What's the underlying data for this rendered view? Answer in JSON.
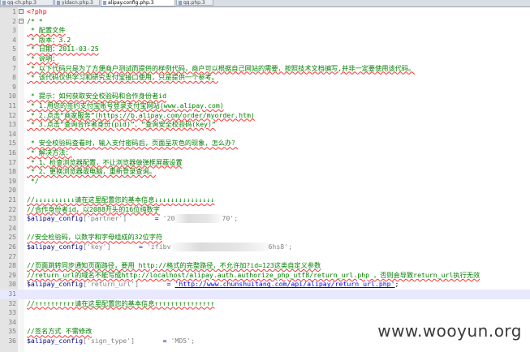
{
  "tabs": [
    {
      "label": "qq-ch.php.3",
      "active": false
    },
    {
      "label": "yidacn.php.3",
      "active": false
    },
    {
      "label": "alipay.config.php.3",
      "active": true
    },
    {
      "label": "qq.php.3",
      "active": false
    }
  ],
  "lines": [
    {
      "n": "1",
      "text": "<?php"
    },
    {
      "n": "2",
      "text": "/* *"
    },
    {
      "n": "3",
      "text": " * 配置文件"
    },
    {
      "n": "4",
      "text": " * 版本：3.2"
    },
    {
      "n": "5",
      "text": " * 日期：2011-03-25"
    },
    {
      "n": "6",
      "text": " * 说明："
    },
    {
      "n": "7",
      "text": " * 以下代码只是为了方便商户测试而提供的样例代码，商户可以根据自己网站的需要，按照技术文档编写,并非一定要使用该代码。"
    },
    {
      "n": "8",
      "text": " * 该代码仅供学习和研究支付宝接口使用，只是提供一个参考。"
    },
    {
      "n": "9",
      "text": ""
    },
    {
      "n": "10",
      "text": " * 提示：如何获取安全校验码和合作身份者id"
    },
    {
      "n": "11",
      "text": " * 1.用您的签约支付宝账号登录支付宝网站(www.alipay.com)"
    },
    {
      "n": "12",
      "text": " * 2.点击“商家服务”(https://b.alipay.com/order/myorder.htm)"
    },
    {
      "n": "13",
      "text": " * 3.点击“查询合作者身份(pid)”、“查询安全校验码(key)”"
    },
    {
      "n": "14",
      "text": ""
    },
    {
      "n": "15",
      "text": " * 安全校验码查看时，输入支付密码后，页面呈灰色的现象，怎么办？"
    },
    {
      "n": "16",
      "text": " * 解决方法："
    },
    {
      "n": "17",
      "text": " * 1、检查浏览器配置，不让浏览器做弹框屏蔽设置"
    },
    {
      "n": "18",
      "text": " * 2、更换浏览器或电脑，重新登录查询。"
    },
    {
      "n": "19",
      "text": " */"
    },
    {
      "n": "20",
      "text": ""
    },
    {
      "n": "21",
      "text": "//↓↓↓↓↓↓↓↓↓↓请在这里配置您的基本信息↓↓↓↓↓↓↓↓↓↓↓↓↓↓↓"
    },
    {
      "n": "22",
      "text": "//合作身份者id，以2088开头的16位纯数字"
    },
    {
      "n": "23",
      "var": "$alipay_config",
      "key": "['partner']",
      "eq": "=",
      "val_pre": "'20",
      "val_post": "70';"
    },
    {
      "n": "24",
      "text": ""
    },
    {
      "n": "25",
      "text": "//安全检验码，以数字和字母组成的32位字符"
    },
    {
      "n": "26",
      "var": "$alipay_config",
      "key": "['key']",
      "eq": "=",
      "val_pre": "'zfibv",
      "val_post": "6hs8';"
    },
    {
      "n": "27",
      "text": ""
    },
    {
      "n": "28",
      "text": "//页面跳转同步通知页面路径，要用 http://格式的完整路径，不允许加?id=123这类自定义参数"
    },
    {
      "n": "29",
      "text": "//return_url的域名不能写成http://localhost/alipay.auth.authorize_php_utf8/return_url.php ，否则会导致return_url执行无效"
    },
    {
      "n": "30",
      "var": "$alipay_config",
      "key": "['return_url']",
      "eq": "=",
      "val_url": "'http://www.chunshuitang.com/api/alipay/return_url.php'",
      "tail": ";"
    },
    {
      "n": "31",
      "text": ""
    },
    {
      "n": "32",
      "text": "//↑↑↑↑↑↑↑↑↑↑请在这里配置您的基本信息↑↑↑↑↑↑↑↑↑↑↑↑↑↑↑"
    },
    {
      "n": "33",
      "text": ""
    },
    {
      "n": "34",
      "text": ""
    },
    {
      "n": "35",
      "text": "//签名方式 不需修改"
    },
    {
      "n": "36",
      "var": "$alipay_config",
      "key": "['sign_type']",
      "eq": "=",
      "val_str": "'MD5';"
    }
  ],
  "watermark": "www.wooyun.org"
}
